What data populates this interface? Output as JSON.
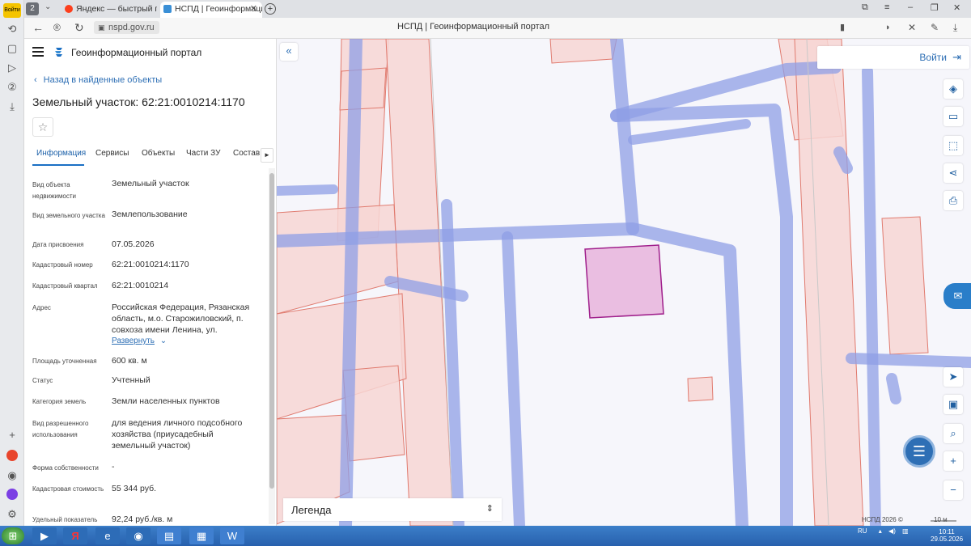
{
  "browser": {
    "tab_count": "2",
    "tabs": [
      {
        "label": "Яндекс — быстрый поиск"
      },
      {
        "label": "НСПД | Геоинформационный портал"
      }
    ],
    "url": "nspd.gov.ru",
    "page_title": "НСПД | Геоинформационный портал",
    "corner_badge": "Войти"
  },
  "panel": {
    "portal_name": "Геоинформационный портал",
    "back_link": "Назад в найденные объекты",
    "title": "Земельный участок: 62:21:0010214:1170",
    "tabs": [
      "Информация",
      "Сервисы",
      "Объекты",
      "Части ЗУ",
      "Состав"
    ],
    "fields": [
      {
        "label": "Вид объекта недвижимости",
        "value": "Земельный участок"
      },
      {
        "label": "Вид земельного участка",
        "value": "Землепользование"
      },
      {
        "label": "Дата присвоения",
        "value": "07.05.2026"
      },
      {
        "label": "Кадастровый номер",
        "value": "62:21:0010214:1170"
      },
      {
        "label": "Кадастровый квартал",
        "value": "62:21:0010214"
      },
      {
        "label": "Адрес",
        "value": "Российская Федерация, Рязанская область, м.о. Старожиловский, п. совхоза имени Ленина, ул."
      },
      {
        "label": "Площадь уточненная",
        "value": "600 кв. м"
      },
      {
        "label": "Статус",
        "value": "Учтенный"
      },
      {
        "label": "Категория земель",
        "value": "Земли населенных пунктов"
      },
      {
        "label": "Вид разрешенного использования",
        "value": "для ведения личного подсобного хозяйства (приусадебный земельный участок)"
      },
      {
        "label": "Форма собственности",
        "value": "-"
      },
      {
        "label": "Кадастровая стоимость",
        "value": "55 344 руб."
      },
      {
        "label": "Удельный показатель",
        "value": "92,24 руб./кв. м"
      }
    ],
    "expand_link": "Развернуть"
  },
  "map": {
    "login_label": "Войти",
    "legend_label": "Легенда",
    "copyright": "НСПД 2026 ©",
    "scale_label": "10 м",
    "colors": {
      "road": "#9aa8e8",
      "parcel_fill": "#f7d6d4",
      "parcel_stroke": "#e07a6e",
      "selected_fill": "#e8b4dc",
      "selected_stroke": "#a0208c"
    }
  },
  "taskbar": {
    "lang": "RU",
    "time": "10:11",
    "date": "29.05.2026"
  }
}
